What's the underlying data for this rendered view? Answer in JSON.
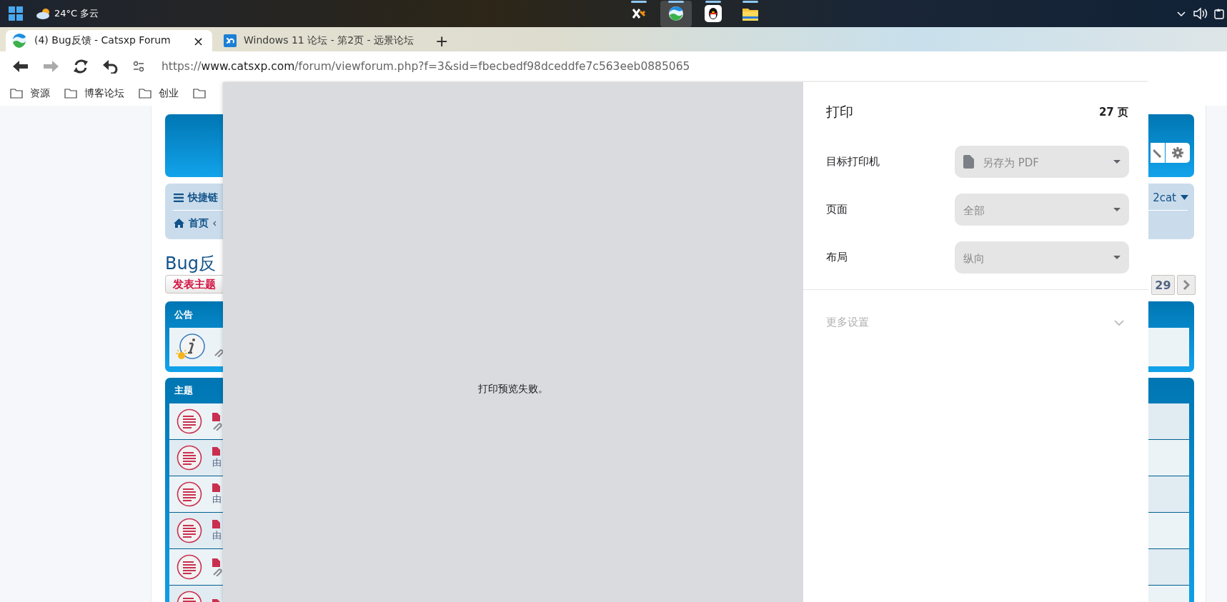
{
  "taskbar": {
    "weather": "24°C 多云",
    "apps": [
      {
        "kind": "tool",
        "selected": false,
        "running": true
      },
      {
        "kind": "browser",
        "selected": true,
        "running": true
      },
      {
        "kind": "qq",
        "selected": false,
        "running": true
      },
      {
        "kind": "folder",
        "selected": false,
        "running": true
      }
    ]
  },
  "browser": {
    "tabs": [
      {
        "title": "(4) Bug反馈 - Catsxp Forum",
        "selected": true,
        "kind": "browser",
        "close": "×"
      },
      {
        "title": "Windows 11 论坛 - 第2页 - 远景论坛",
        "selected": false,
        "kind": "pc"
      }
    ],
    "new_tab": "+",
    "url": "https://**www.catsxp.com**/forum/viewforum.php?f=3&sid=fbecbedf98dceddfe7c563eeb0885065",
    "bookmarks": [
      {
        "kind": "folder",
        "label": "资源"
      },
      {
        "kind": "folder",
        "label": "博客论坛"
      },
      {
        "kind": "folder",
        "label": "创业"
      },
      {
        "kind": "folder"
      }
    ]
  },
  "forum": {
    "quick_links": "快捷链",
    "home": "首页",
    "user": "2cat",
    "title": "Bug反",
    "new_topic": "发表主题",
    "last_page": "29",
    "announcements": {
      "header": "公告"
    },
    "topics": {
      "header": "主题",
      "rows": [
        {
          "kind": "attachment"
        },
        {
          "kind": "byline",
          "byline": "由"
        },
        {
          "kind": "byline",
          "byline": "由"
        },
        {
          "kind": "byline",
          "byline": "由"
        },
        {
          "kind": "attachment"
        },
        {
          "kind": "plain"
        }
      ]
    }
  },
  "print_dialog": {
    "preview_message": "打印预览失败。",
    "title": "打印",
    "page_count": "27 页",
    "settings": [
      {
        "kind": "printer",
        "label": "目标打印机",
        "value": "另存为 PDF",
        "disabled": true
      },
      {
        "kind": "plain",
        "label": "页面",
        "value": "全部",
        "disabled": true
      },
      {
        "kind": "plain",
        "label": "布局",
        "value": "纵向",
        "disabled": true
      }
    ],
    "more_settings": "更多设置",
    "more_expanded": false
  }
}
